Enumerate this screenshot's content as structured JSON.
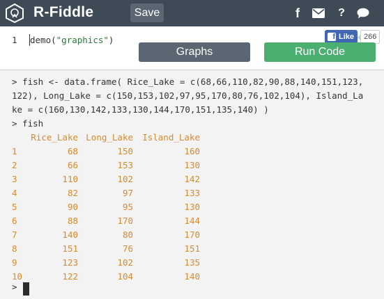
{
  "header": {
    "brand": "R-Fiddle",
    "save_label": "Save",
    "icons": [
      "facebook-icon",
      "mail-icon",
      "help-icon",
      "chat-icon"
    ],
    "help_glyph": "?",
    "fb_glyph": "f"
  },
  "editor": {
    "line_number": "1",
    "code_fn": "demo(",
    "code_str": "\"graphics\"",
    "code_end": ")",
    "fb_like_label": "Like",
    "fb_like_count": "266",
    "graphs_label": "Graphs",
    "run_label": "Run Code"
  },
  "console": {
    "input_lines": [
      "> fish <- data.frame( Rice_Lake = c(68,66,110,82,90,88,140,151,123,",
      "122), Long_Lake = c(150,153,102,97,95,170,80,76,102,104), Island_La",
      "ke = c(160,130,142,133,130,144,170,151,135,140) )",
      "> fish"
    ],
    "table": {
      "columns": [
        "Rice_Lake",
        "Long_Lake",
        "Island_Lake"
      ],
      "rows": [
        {
          "row": "1",
          "values": [
            "68",
            "150",
            "160"
          ]
        },
        {
          "row": "2",
          "values": [
            "66",
            "153",
            "130"
          ]
        },
        {
          "row": "3",
          "values": [
            "110",
            "102",
            "142"
          ]
        },
        {
          "row": "4",
          "values": [
            "82",
            "97",
            "133"
          ]
        },
        {
          "row": "5",
          "values": [
            "90",
            "95",
            "130"
          ]
        },
        {
          "row": "6",
          "values": [
            "88",
            "170",
            "144"
          ]
        },
        {
          "row": "7",
          "values": [
            "140",
            "80",
            "170"
          ]
        },
        {
          "row": "8",
          "values": [
            "151",
            "76",
            "151"
          ]
        },
        {
          "row": "9",
          "values": [
            "123",
            "102",
            "135"
          ]
        },
        {
          "row": "10",
          "values": [
            "122",
            "104",
            "140"
          ]
        }
      ]
    },
    "prompt": ">"
  },
  "colors": {
    "topbar": "#3e4b57",
    "run_button": "#4caf72",
    "graphs_button": "#5a6772",
    "output_text": "#d88a2c",
    "console_bg": "#f3f3f3"
  }
}
